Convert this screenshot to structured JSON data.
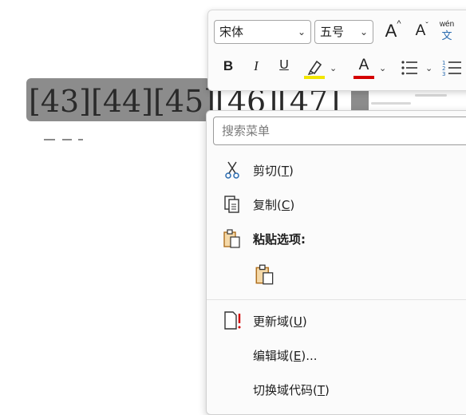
{
  "document": {
    "field_text": "[43][44][45][46][47]"
  },
  "mini_toolbar": {
    "font_name": "宋体",
    "font_size": "五号",
    "grow_font": "A",
    "shrink_font": "A",
    "phonetic_top": "wén",
    "phonetic_bottom": "文",
    "bold": "B",
    "italic": "I",
    "underline": "U",
    "font_color": "A",
    "highlight_color": "#f2e600",
    "text_color": "#d40000"
  },
  "context_menu": {
    "search_placeholder": "搜索菜单",
    "items": [
      {
        "label_pre": "剪切(",
        "key": "T",
        "label_post": ")"
      },
      {
        "label_pre": "复制(",
        "key": "C",
        "label_post": ")"
      },
      {
        "label_pre": "粘贴选项:",
        "key": "",
        "label_post": ""
      },
      {
        "label_pre": "更新域(",
        "key": "U",
        "label_post": ")"
      },
      {
        "label_pre": "编辑域(",
        "key": "E",
        "label_post": ")..."
      },
      {
        "label_pre": "切换域代码(",
        "key": "T",
        "label_post": ")"
      }
    ]
  }
}
